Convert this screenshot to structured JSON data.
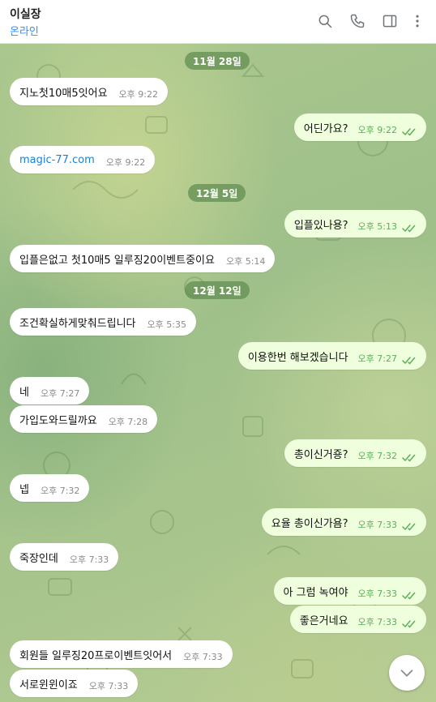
{
  "header": {
    "title": "이실장",
    "status": "온라인",
    "icons": [
      "search-icon",
      "phone-icon",
      "sidebar-toggle-icon",
      "more-icon"
    ]
  },
  "theme": {
    "status_color": "#3390ec",
    "incoming_bg": "#ffffff",
    "outgoing_bg": "#effedd",
    "check_color": "#5dae5a"
  },
  "chat": {
    "dates": [
      "11월 28일",
      "12월 5일",
      "12월 12일"
    ],
    "messages": [
      {
        "dir": "in",
        "text": "지노첫10매5잇어요",
        "time": "오후 9:22"
      },
      {
        "dir": "out",
        "text": "어딘가요?",
        "time": "오후 9:22",
        "read": true
      },
      {
        "dir": "in",
        "text": "magic-77.com",
        "time": "오후 9:22",
        "is_link": true
      },
      {
        "dir": "out",
        "text": "입플있나용?",
        "time": "오후 5:13",
        "read": true
      },
      {
        "dir": "in",
        "text": "입플은없고 첫10매5 일루징20이벤트중이요",
        "time": "오후 5:14"
      },
      {
        "dir": "in",
        "text": "조건확실하게맞춰드립니다",
        "time": "오후 5:35"
      },
      {
        "dir": "out",
        "text": "이용한번 해보겠습니다",
        "time": "오후 7:27",
        "read": true
      },
      {
        "dir": "in",
        "text": "네",
        "time": "오후 7:27"
      },
      {
        "dir": "in",
        "text": "가입도와드릴까요",
        "time": "오후 7:28"
      },
      {
        "dir": "out",
        "text": "총이신거죵?",
        "time": "오후 7:32",
        "read": true
      },
      {
        "dir": "in",
        "text": "넵",
        "time": "오후 7:32"
      },
      {
        "dir": "out",
        "text": "요율 총이신가욤?",
        "time": "오후 7:33",
        "read": true
      },
      {
        "dir": "in",
        "text": "죽장인데",
        "time": "오후 7:33"
      },
      {
        "dir": "out",
        "text": "아 그럼 녹여야",
        "time": "오후 7:33",
        "read": true
      },
      {
        "dir": "out",
        "text": "좋은거네요",
        "time": "오후 7:33",
        "read": true
      },
      {
        "dir": "in",
        "text": "회원들 일루징20프로이벤트잇어서",
        "time": "오후 7:33"
      },
      {
        "dir": "in",
        "text": "서로윈윈이죠",
        "time": "오후 7:33"
      }
    ]
  }
}
